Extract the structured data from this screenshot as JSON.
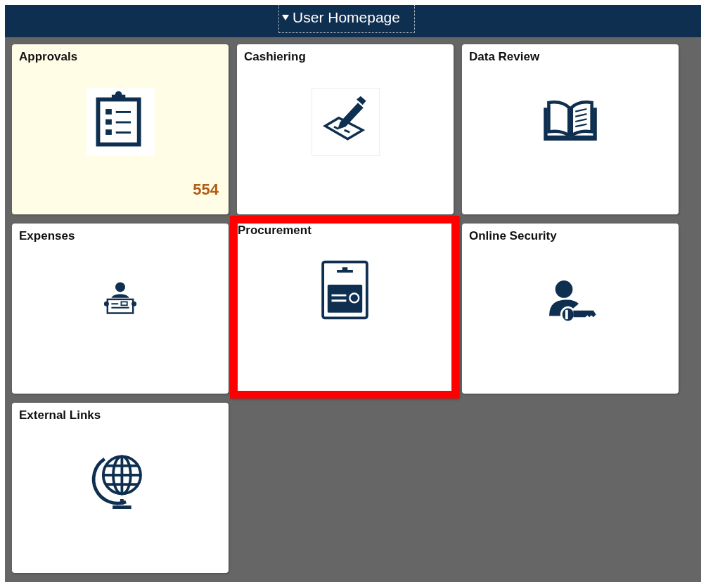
{
  "header": {
    "title": "User Homepage",
    "focused": true
  },
  "tiles": [
    {
      "label": "Approvals",
      "kind": "clipboard",
      "tinted": true,
      "highlighted": false,
      "badge": "554"
    },
    {
      "label": "Cashiering",
      "kind": "signing",
      "tinted": false,
      "highlighted": false
    },
    {
      "label": "Data Review",
      "kind": "book",
      "tinted": false,
      "highlighted": false
    },
    {
      "label": "Expenses",
      "kind": "cashier",
      "tinted": false,
      "highlighted": false
    },
    {
      "label": "Procurement",
      "kind": "card",
      "tinted": false,
      "highlighted": true
    },
    {
      "label": "Online Security",
      "kind": "userkey",
      "tinted": false,
      "highlighted": false
    },
    {
      "label": "External Links",
      "kind": "globe",
      "tinted": false,
      "highlighted": false
    }
  ]
}
